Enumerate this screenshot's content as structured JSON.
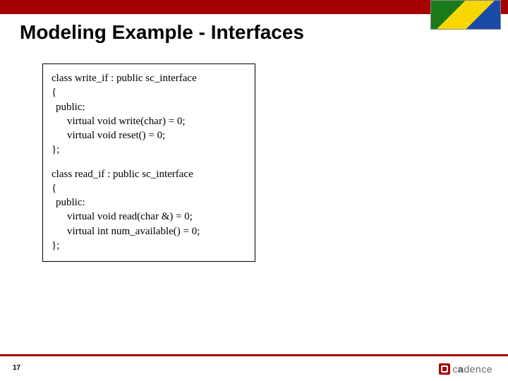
{
  "header": {
    "title": "Modeling Example - Interfaces"
  },
  "code": {
    "write_if": {
      "decl": "class write_if : public sc_interface",
      "open": "{",
      "pub": "public:",
      "m1": "virtual void write(char) = 0;",
      "m2": "virtual void reset() = 0;",
      "close": "};"
    },
    "read_if": {
      "decl": "class read_if : public sc_interface",
      "open": "{",
      "pub": "public:",
      "m1": "virtual void read(char &) = 0;",
      "m2": "virtual int num_available() = 0;",
      "close": "};"
    }
  },
  "footer": {
    "page": "17",
    "brand_light": "c",
    "brand_bold": "a",
    "brand_rest": "dence"
  }
}
